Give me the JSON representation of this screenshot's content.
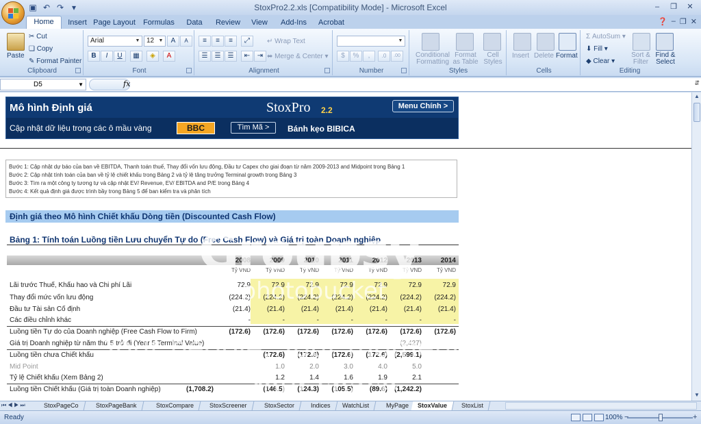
{
  "window": {
    "title": "StoxPro2.2.xls  [Compatibility Mode] - Microsoft Excel",
    "minimize": "–",
    "restore": "❐",
    "close": "✕"
  },
  "ribbon_tabs": [
    "Home",
    "Insert",
    "Page Layout",
    "Formulas",
    "Data",
    "Review",
    "View",
    "Add-Ins",
    "Acrobat"
  ],
  "ribbon": {
    "clipboard": {
      "label": "Clipboard",
      "paste": "Paste",
      "cut": "Cut",
      "copy": "Copy",
      "format_painter": "Format Painter"
    },
    "font": {
      "label": "Font",
      "font_name": "Arial",
      "font_size": "12",
      "bold": "B",
      "italic": "I",
      "underline": "U",
      "grow": "A",
      "shrink": "A"
    },
    "alignment": {
      "label": "Alignment",
      "wrap_text": "Wrap Text",
      "merge_center": "Merge & Center"
    },
    "number": {
      "label": "Number",
      "currency": "$",
      "percent": "%",
      "comma": ",",
      "inc_dec": ".0",
      "dec_dec": ".00"
    },
    "styles": {
      "label": "Styles",
      "conditional": "Conditional Formatting",
      "format_table": "Format as Table",
      "cell_styles": "Cell Styles"
    },
    "cells": {
      "label": "Cells",
      "insert": "Insert",
      "delete": "Delete",
      "format": "Format"
    },
    "editing": {
      "label": "Editing",
      "autosum": "AutoSum",
      "fill": "Fill",
      "clear": "Clear",
      "sort_filter": "Sort & Filter",
      "find_select": "Find & Select"
    }
  },
  "formula_bar": {
    "name_box": "D5",
    "fx": "fx",
    "content": ""
  },
  "model": {
    "title": "Mô hình Định giá",
    "brand": "StoxPro",
    "version": "2.2",
    "menu_button": "Menu Chính >",
    "update_label": "Cập nhật dữ liệu trong các ô mầu vàng",
    "ticker": "BBC",
    "find_button": "Tìm Mã >",
    "company": "Bánh kẹo BIBICA"
  },
  "steps": [
    "Bước 1:  Cập nhật dự báo của ban về EBITDA, Thanh toán thuế, Thay đổi vốn lưu động, Đầu tư Capex cho giai đoạn từ năm 2009-2013 and Midpoint trong Bảng 1",
    "Bước 2:  Cập nhật tính toán của ban về tỷ lệ chiết khấu trong Bảng 2 và tỷ lệ tăng trưởng Terminal growth trong Bảng 3",
    "Bước 3:  Tìm ra một công ty tương tự và cập nhật EV/ Revenue, EV/ EBITDA and P/E trong Bảng 4",
    "Bước 4:  Kết quả định giá được trình bầy trong Bảng 5 để ban kiểm tra và phân tích"
  ],
  "section_header": "Định giá theo Mô hình Chiết khấu Dòng tiền (Discounted Cash Flow)",
  "table_title": "Bảng 1: Tính toán Luồng tiền Lưu chuyển Tự do (Free Cash Flow) và Giá trị toàn Doanh nghiệp",
  "table": {
    "years": [
      "2008",
      "2009",
      "2010",
      "2011",
      "2012",
      "2013",
      "2014"
    ],
    "units": [
      "Tỷ VND",
      "Tỷ VND",
      "Tỷ VND",
      "Tỷ VND",
      "Tỷ VND",
      "Tỷ VND",
      "Tỷ VND"
    ],
    "rows": [
      {
        "label": "Lãi trước Thuế, Khấu hao và Chi phí Lãi",
        "values": [
          "72.9",
          "72.9",
          "72.9",
          "72.9",
          "72.9",
          "72.9",
          "72.9"
        ]
      },
      {
        "label": "Thay đổi mức vốn lưu động",
        "values": [
          "(224.2)",
          "(224.2)",
          "(224.2)",
          "(224.2)",
          "(224.2)",
          "(224.2)",
          "(224.2)"
        ]
      },
      {
        "label": "Đầu tư Tài sản Cố định",
        "values": [
          "(21.4)",
          "(21.4)",
          "(21.4)",
          "(21.4)",
          "(21.4)",
          "(21.4)",
          "(21.4)"
        ]
      },
      {
        "label": "Các điều chỉnh khác",
        "values": [
          "-",
          "-",
          "-",
          "-",
          "-",
          "-",
          "-"
        ]
      },
      {
        "label": "Luồng tiền Tự do của Doanh nghiệp (Free Cash Flow to Firm)",
        "values": [
          "(172.6)",
          "(172.6)",
          "(172.6)",
          "(172.6)",
          "(172.6)",
          "(172.6)",
          "(172.6)"
        ]
      },
      {
        "label": "Giá trị Doanh nghiệp từ năm thứ 5 trở đi (Year 5 Terminal Value)",
        "values": [
          "",
          "",
          "",
          "",
          "",
          "(2,427)",
          ""
        ]
      },
      {
        "label": "Luồng tiền chưa Chiết khấu",
        "values": [
          "",
          "(172.6)",
          "(172.6)",
          "(172.6)",
          "(172.6)",
          "(2,599.1)",
          ""
        ]
      },
      {
        "label": "Mid Point",
        "values": [
          "",
          "1.0",
          "2.0",
          "3.0",
          "4.0",
          "5.0",
          ""
        ]
      },
      {
        "label": "Tỷ lệ Chiết khấu (Xem Bảng 2)",
        "values": [
          "",
          "1.2",
          "1.4",
          "1.6",
          "1.9",
          "2.1",
          ""
        ]
      },
      {
        "label": "Luồng tiền Chiết khấu (Giá trị toàn Doanh nghiệp)",
        "total": "(1,708.2)",
        "values": [
          "",
          "(146.5)",
          "(124.3)",
          "(105.5)",
          "(89.6)",
          "(1,242.2)",
          ""
        ]
      }
    ]
  },
  "sheet_tabs": [
    "StoxPageCo",
    "StoxPageBank",
    "StoxCompare",
    "StoxScreener",
    "StoxSector",
    "Indices",
    "WatchList",
    "MyPage",
    "StoxValue",
    "StoxList"
  ],
  "active_sheet": "StoxValue",
  "status": {
    "text": "Ready",
    "zoom": "100%",
    "zoom_out": "−",
    "zoom_in": "+"
  },
  "watermark": {
    "logo": "Groupsy",
    "by": "by photobucket",
    "tagline_1": "Your people. Your moments.",
    "tagline_2": "Your space."
  }
}
